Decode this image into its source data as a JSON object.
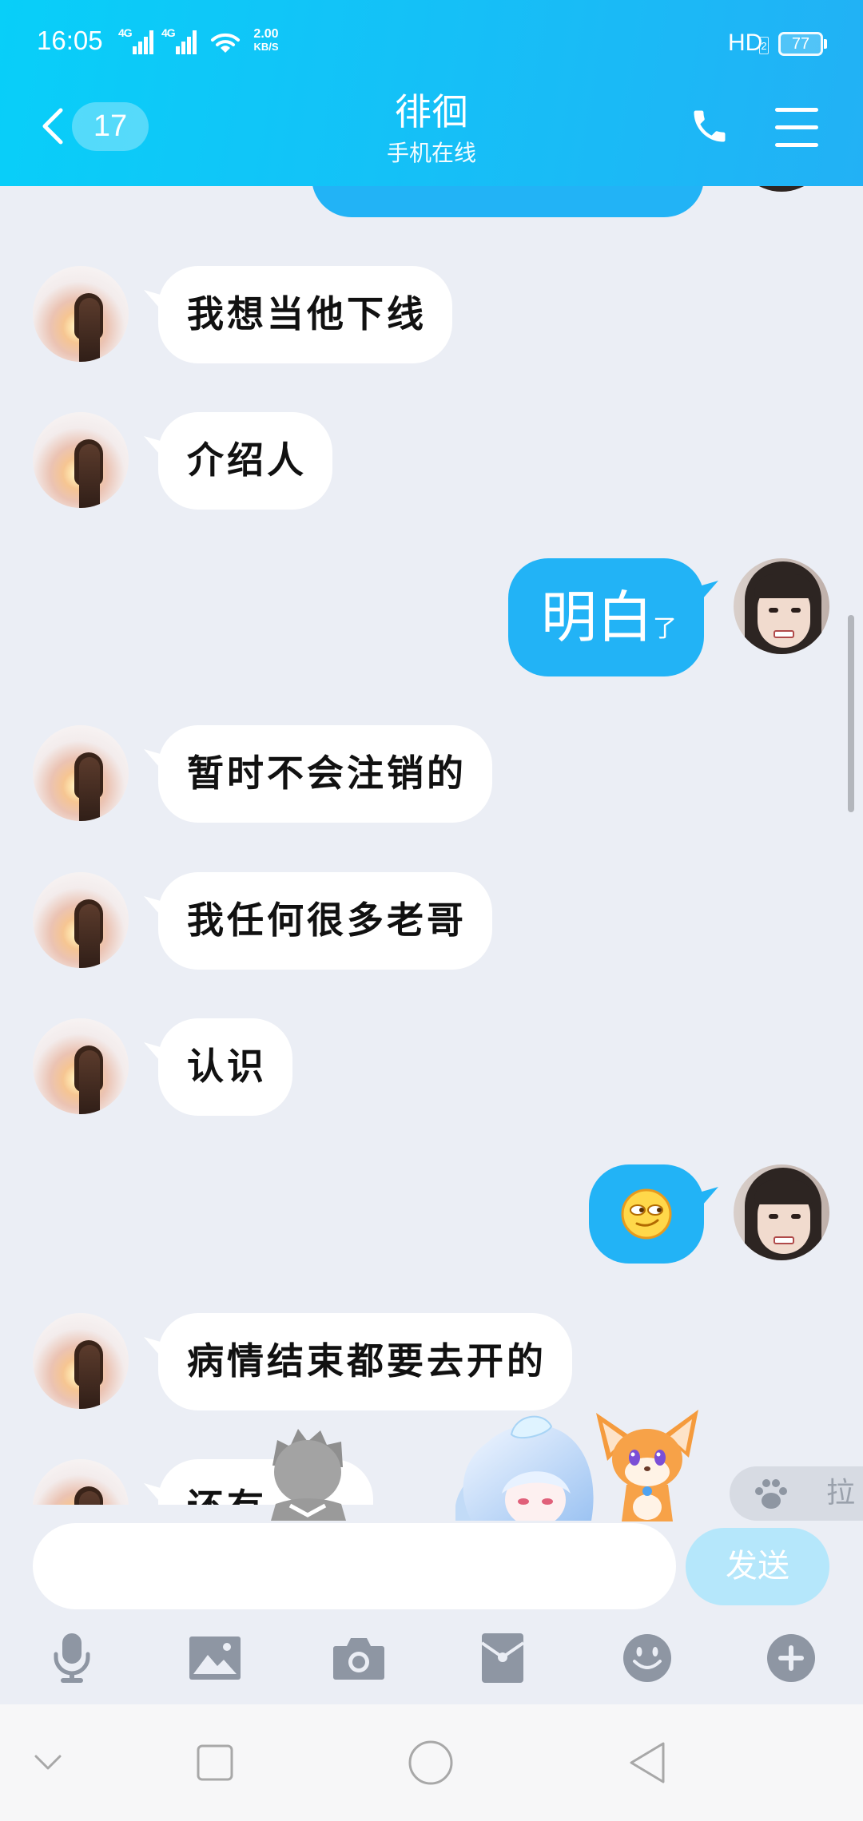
{
  "colors": {
    "header_start": "#08cff9",
    "header_end": "#22b1f5",
    "chat_background": "#ebeef5",
    "sent_bubble": "#22b3f6",
    "received_bubble": "#ffffff",
    "send_button": "#b5e7fb",
    "toolbar_icon": "#8e96a3",
    "nav_bar": "#f7f7f8"
  },
  "status_bar": {
    "time": "16:05",
    "signal_1_label": "4G",
    "signal_2_label": "4G",
    "net_speed_value": "2.00",
    "net_speed_unit": "KB/S",
    "hd_label": "HD",
    "hd_sim": "2",
    "battery_level": "77"
  },
  "header": {
    "unread_count": "17",
    "title": "徘徊",
    "subtitle": "手机在线",
    "icons": {
      "back": "chevron-left-icon",
      "call": "phone-icon",
      "menu": "menu-icon"
    }
  },
  "messages": [
    {
      "sender": "other",
      "avatar": "sunset-girl-avatar",
      "text": "我想当他下线"
    },
    {
      "sender": "other",
      "avatar": "sunset-girl-avatar",
      "text": "介绍人"
    },
    {
      "sender": "self",
      "avatar": "girl-avatar",
      "text_large": "明白",
      "text_small": "了"
    },
    {
      "sender": "other",
      "avatar": "sunset-girl-avatar",
      "text": "暂时不会注销的"
    },
    {
      "sender": "other",
      "avatar": "sunset-girl-avatar",
      "text": "我任何很多老哥"
    },
    {
      "sender": "other",
      "avatar": "sunset-girl-avatar",
      "text": "认识"
    },
    {
      "sender": "self",
      "avatar": "girl-avatar",
      "emoji": "smirk-emoji"
    },
    {
      "sender": "other",
      "avatar": "sunset-girl-avatar",
      "text": "病情结束都要去开的"
    },
    {
      "sender": "other",
      "avatar": "sunset-girl-avatar",
      "text": "还有"
    }
  ],
  "pull_button": {
    "icon": "paw-icon",
    "label": "拉"
  },
  "input": {
    "value": ""
  },
  "send_button": {
    "label": "发送"
  },
  "toolbar": [
    {
      "icon": "microphone-icon"
    },
    {
      "icon": "image-icon"
    },
    {
      "icon": "camera-icon"
    },
    {
      "icon": "red-packet-icon"
    },
    {
      "icon": "emoji-icon"
    },
    {
      "icon": "plus-icon"
    }
  ],
  "nav_bar": [
    {
      "icon": "chevron-down-icon"
    },
    {
      "icon": "square-icon"
    },
    {
      "icon": "circle-icon"
    },
    {
      "icon": "triangle-back-icon"
    }
  ]
}
